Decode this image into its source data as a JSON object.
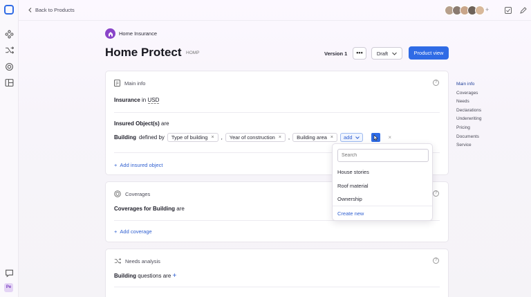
{
  "nav": {
    "back_label": "Back to Products"
  },
  "collab": {
    "avatars": [
      "#b7a08c",
      "#8a7a70",
      "#c9a58a",
      "#6e6259",
      "#d8b89a"
    ],
    "add_label": "+"
  },
  "product": {
    "category": "Home Insurance",
    "title": "Home Protect",
    "code": "HOMP",
    "version": "Version 1",
    "more_label": "•••",
    "status": "Draft",
    "primary_action": "Product view"
  },
  "main_info": {
    "heading": "Main info",
    "insurance_label": "Insurance",
    "in_word": "in",
    "currency": "USD",
    "insured_objects_label": "Insured Object(s)",
    "are_word": "are",
    "object_name": "Building",
    "defined_by": "defined by",
    "attributes": [
      "Type of building",
      "Year of construction",
      "Building area"
    ],
    "separator": ",",
    "add_chip_label": "add",
    "remove_label": "×",
    "add_object_label": "Add insured object"
  },
  "dropdown": {
    "search_placeholder": "Search",
    "options": [
      "House stories",
      "Roof material",
      "Ownership"
    ],
    "create_label": "Create new"
  },
  "coverages": {
    "heading": "Coverages",
    "label_pre": "Coverages for",
    "object": "Building",
    "label_post": "are",
    "add_label": "Add coverage"
  },
  "needs": {
    "heading": "Needs analysis",
    "object": "Building",
    "label_post": "questions are",
    "add_label": "+"
  },
  "toc": {
    "items": [
      "Main info",
      "Coverages",
      "Needs",
      "Declarations",
      "Underwriting",
      "Pricing",
      "Documents",
      "Service"
    ]
  },
  "colors": {
    "accent": "#2f6be5",
    "brand_purple": "#8a45c9"
  },
  "user": {
    "initials": "Pe"
  }
}
